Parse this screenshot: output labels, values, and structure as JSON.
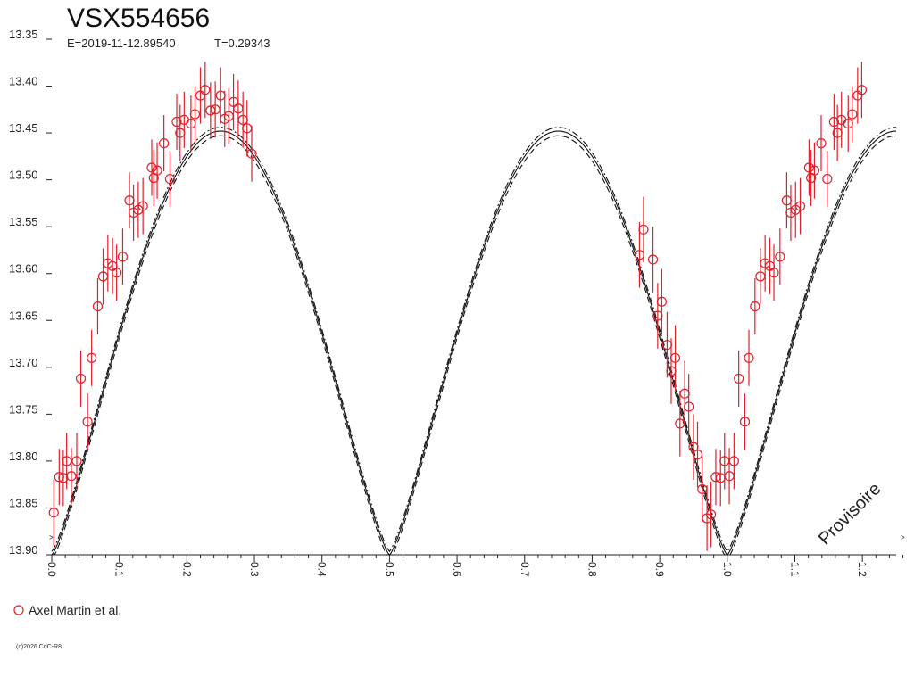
{
  "chart_data": {
    "type": "scatter",
    "title": "VSX554656",
    "subtitle_epoch": "E=2019-11-12.89540",
    "subtitle_period": "T=0.29343",
    "y_reversed": true,
    "ylim": [
      13.35,
      13.9
    ],
    "xlim": [
      0.0,
      1.25
    ],
    "y_ticks": [
      "13.35",
      "13.40",
      "13.45",
      "13.50",
      "13.55",
      "13.60",
      "13.65",
      "13.70",
      "13.75",
      "13.80",
      "13.85",
      "13.90"
    ],
    "x_ticks": [
      "0.0",
      "0.1",
      "0.2",
      "0.3",
      "0.4",
      "0.5",
      "0.6",
      "0.7",
      "0.8",
      "0.9",
      "1.0",
      "1.1",
      "1.2"
    ],
    "grid": false,
    "series": [
      {
        "name": "Axel Martin et al.",
        "color": "#e0202a",
        "marker": "open-circle",
        "error_bars": true,
        "points": [
          [
            0.003,
            13.855,
            0.035
          ],
          [
            0.011,
            13.817,
            0.03
          ],
          [
            0.017,
            13.818,
            0.03
          ],
          [
            0.022,
            13.8,
            0.03
          ],
          [
            0.029,
            13.816,
            0.03
          ],
          [
            0.037,
            13.8,
            0.03
          ],
          [
            0.043,
            13.712,
            0.03
          ],
          [
            0.053,
            13.758,
            0.03
          ],
          [
            0.059,
            13.69,
            0.03
          ],
          [
            0.068,
            13.635,
            0.03
          ],
          [
            0.076,
            13.603,
            0.03
          ],
          [
            0.083,
            13.589,
            0.03
          ],
          [
            0.09,
            13.592,
            0.03
          ],
          [
            0.096,
            13.599,
            0.03
          ],
          [
            0.105,
            13.582,
            0.03
          ],
          [
            0.115,
            13.522,
            0.03
          ],
          [
            0.121,
            13.535,
            0.03
          ],
          [
            0.128,
            13.532,
            0.03
          ],
          [
            0.135,
            13.528,
            0.03
          ],
          [
            0.148,
            13.487,
            0.03
          ],
          [
            0.151,
            13.498,
            0.03
          ],
          [
            0.156,
            13.49,
            0.03
          ],
          [
            0.166,
            13.461,
            0.03
          ],
          [
            0.175,
            13.499,
            0.03
          ],
          [
            0.185,
            13.438,
            0.03
          ],
          [
            0.19,
            13.45,
            0.03
          ],
          [
            0.196,
            13.436,
            0.03
          ],
          [
            0.206,
            13.44,
            0.03
          ],
          [
            0.212,
            13.43,
            0.03
          ],
          [
            0.22,
            13.41,
            0.03
          ],
          [
            0.227,
            13.404,
            0.03
          ],
          [
            0.235,
            13.426,
            0.03
          ],
          [
            0.242,
            13.425,
            0.03
          ],
          [
            0.25,
            13.41,
            0.03
          ],
          [
            0.256,
            13.435,
            0.03
          ],
          [
            0.262,
            13.432,
            0.03
          ],
          [
            0.269,
            13.417,
            0.03
          ],
          [
            0.276,
            13.424,
            0.03
          ],
          [
            0.283,
            13.436,
            0.03
          ],
          [
            0.289,
            13.445,
            0.03
          ],
          [
            0.296,
            13.472,
            0.03
          ],
          [
            0.87,
            13.58,
            0.035
          ],
          [
            0.876,
            13.553,
            0.035
          ],
          [
            0.89,
            13.585,
            0.035
          ],
          [
            0.897,
            13.645,
            0.035
          ],
          [
            0.903,
            13.63,
            0.035
          ],
          [
            0.911,
            13.676,
            0.035
          ],
          [
            0.917,
            13.704,
            0.035
          ],
          [
            0.923,
            13.69,
            0.035
          ],
          [
            0.93,
            13.76,
            0.035
          ],
          [
            0.937,
            13.728,
            0.035
          ],
          [
            0.943,
            13.742,
            0.035
          ],
          [
            0.95,
            13.785,
            0.035
          ],
          [
            0.956,
            13.793,
            0.035
          ],
          [
            0.963,
            13.83,
            0.035
          ],
          [
            0.97,
            13.861,
            0.035
          ],
          [
            0.976,
            13.857,
            0.035
          ],
          [
            0.983,
            13.817,
            0.03
          ],
          [
            0.99,
            13.818,
            0.03
          ],
          [
            0.996,
            13.8,
            0.03
          ],
          [
            1.003,
            13.816,
            0.03
          ],
          [
            1.01,
            13.8,
            0.03
          ],
          [
            1.017,
            13.712,
            0.03
          ],
          [
            1.026,
            13.758,
            0.03
          ],
          [
            1.032,
            13.69,
            0.03
          ],
          [
            1.041,
            13.635,
            0.03
          ],
          [
            1.049,
            13.603,
            0.03
          ],
          [
            1.056,
            13.589,
            0.03
          ],
          [
            1.063,
            13.592,
            0.03
          ],
          [
            1.069,
            13.599,
            0.03
          ],
          [
            1.078,
            13.582,
            0.03
          ],
          [
            1.088,
            13.522,
            0.03
          ],
          [
            1.094,
            13.535,
            0.03
          ],
          [
            1.101,
            13.532,
            0.03
          ],
          [
            1.108,
            13.528,
            0.03
          ],
          [
            1.121,
            13.487,
            0.03
          ],
          [
            1.124,
            13.498,
            0.03
          ],
          [
            1.129,
            13.49,
            0.03
          ],
          [
            1.139,
            13.461,
            0.03
          ],
          [
            1.148,
            13.499,
            0.03
          ],
          [
            1.158,
            13.438,
            0.03
          ],
          [
            1.163,
            13.45,
            0.03
          ],
          [
            1.169,
            13.436,
            0.03
          ],
          [
            1.179,
            13.44,
            0.03
          ],
          [
            1.185,
            13.43,
            0.03
          ],
          [
            1.193,
            13.41,
            0.03
          ],
          [
            1.199,
            13.404,
            0.03
          ]
        ]
      }
    ],
    "model_curves": {
      "color": "#111111",
      "max_mag": 13.448,
      "min_mag": 13.895,
      "eclipse_width": 0.03,
      "offsets": [
        -0.004,
        0.0,
        0.005
      ],
      "styles": [
        "dashdot",
        "solid",
        "dashed"
      ]
    },
    "legend": {
      "label": "Axel Martin et al.",
      "placement": "bottom-left"
    },
    "watermark": "Provisoire",
    "copyright": "(c)2026 CdC-R8",
    "edge_marks": {
      "left": "^",
      "right": "^"
    }
  }
}
